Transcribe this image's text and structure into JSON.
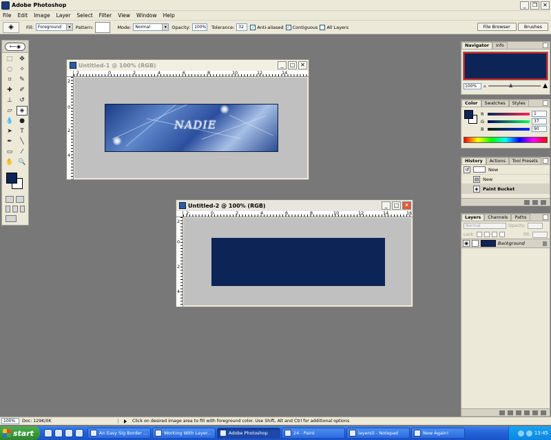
{
  "app": {
    "title": "Adobe Photoshop"
  },
  "menu": [
    "File",
    "Edit",
    "Image",
    "Layer",
    "Select",
    "Filter",
    "View",
    "Window",
    "Help"
  ],
  "options": {
    "fill_label": "Fill:",
    "fill_value": "Foreground",
    "pattern_label": "Pattern:",
    "mode_label": "Mode:",
    "mode_value": "Normal",
    "opacity_label": "Opacity:",
    "opacity_value": "100%",
    "tolerance_label": "Tolerance:",
    "tolerance_value": "32",
    "anti_aliased": "Anti-aliased",
    "contiguous": "Contiguous",
    "all_layers": "All Layers",
    "palette_well": [
      "File Browser",
      "Brushes"
    ]
  },
  "documents": [
    {
      "title": "Untitled-1 @ 100% (RGB)",
      "state": "inactive",
      "ruler_h": [
        "2",
        "0",
        "2",
        "4",
        "6",
        "8",
        "10",
        "12",
        "14"
      ],
      "ruler_v": [
        "2",
        "0",
        "2",
        "4"
      ],
      "sig_text": "NADIE"
    },
    {
      "title": "Untitled-2 @ 100% (RGB)",
      "state": "active",
      "ruler_h": [
        "2",
        "0",
        "2",
        "4",
        "6",
        "8",
        "10",
        "12",
        "14",
        "16"
      ],
      "ruler_v": [
        "2",
        "0",
        "2",
        "4"
      ]
    }
  ],
  "navigator": {
    "tabs": [
      "Navigator",
      "Info"
    ],
    "zoom": "100%"
  },
  "color": {
    "tabs": [
      "Color",
      "Swatches",
      "Styles"
    ],
    "r": "1",
    "g": "37",
    "b": "90",
    "r_label": "R",
    "g_label": "G",
    "b_label": "B",
    "fg_hex": "#0f2557"
  },
  "history": {
    "tabs": [
      "History",
      "Actions",
      "Tool Presets"
    ],
    "snapshot": "New",
    "items": [
      "New",
      "Paint Bucket"
    ]
  },
  "layers": {
    "tabs": [
      "Layers",
      "Channels",
      "Paths"
    ],
    "blend": "Normal",
    "opacity_label": "Opacity:",
    "fill_label": "Fill:",
    "lock_label": "Lock:",
    "layer_name": "Background"
  },
  "status": {
    "zoom": "100%",
    "doc": "Doc: 129K/0K",
    "hint": "Click on desired image area to fill with foreground color. Use Shift, Alt and Ctrl for additional options"
  },
  "taskbar": {
    "start": "start",
    "tasks": [
      "An Easy Sig Border ...",
      "Working With Layer...",
      "Adobe Photoshop",
      "24 - Paint",
      "layers5 - Notepad",
      "New Again!"
    ],
    "clock": "13:45"
  },
  "colors": {
    "navy": "#0d2456",
    "workspace": "#787878"
  }
}
